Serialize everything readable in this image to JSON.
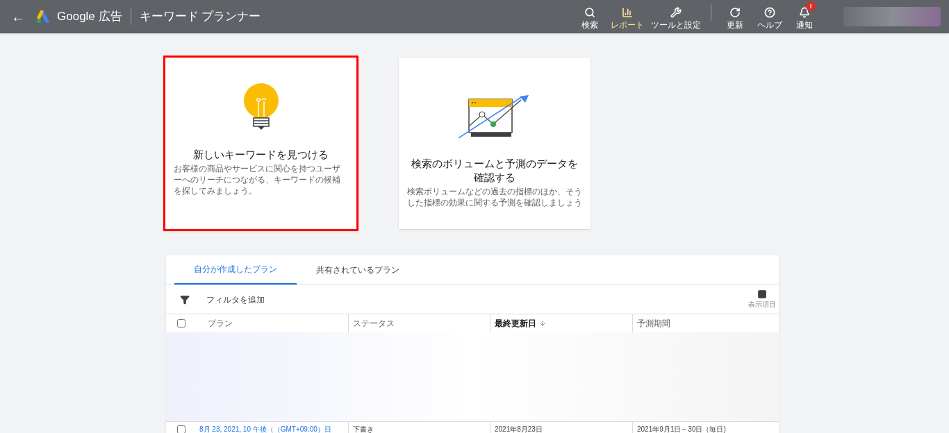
{
  "header": {
    "back": "←",
    "product": "Google 広告",
    "page_title": "キーワード プランナー",
    "actions": [
      {
        "kind": "search",
        "label": "検索",
        "selected": false
      },
      {
        "kind": "report",
        "label": "レポート",
        "selected": true
      },
      {
        "kind": "tools",
        "label": "ツールと設定",
        "selected": false
      },
      {
        "kind": "refresh",
        "label": "更新",
        "selected": false
      },
      {
        "kind": "help",
        "label": "ヘルプ",
        "selected": false
      },
      {
        "kind": "bell",
        "label": "通知",
        "selected": false,
        "badge": "!"
      }
    ]
  },
  "cards": [
    {
      "kind": "bulb",
      "title": "新しいキーワードを見つける",
      "description": "お客様の商品やサービスに関心を持つユーザーへのリーチにつながる、キーワードの候補を探してみましょう。",
      "highlighted": true
    },
    {
      "kind": "chart",
      "title": "検索のボリュームと予測のデータを確認する",
      "description": "検索ボリュームなどの過去の指標のほか、そうした指標の効果に関する予測を確認しましょう",
      "highlighted": false
    }
  ],
  "plans": {
    "tabs": [
      {
        "label": "自分が作成したプラン",
        "selected": true
      },
      {
        "label": "共有されているプラン",
        "selected": false
      }
    ],
    "all_checked": false,
    "filter": "フィルタを追加",
    "columns_button": "表示項目",
    "columns": [
      {
        "label": "プラン",
        "sorted": false
      },
      {
        "label": "ステータス",
        "sorted": false
      },
      {
        "label": "最終更新日",
        "sorted": true
      },
      {
        "label": "予測期間",
        "sorted": false
      }
    ],
    "rows": [
      {
        "checked": false,
        "cells": [
          "8月 23, 2021, 10 午後（（GMT+09:00）日",
          "下書き",
          "2021年8月23日",
          "2021年9月1日～30日（毎日)"
        ]
      }
    ]
  }
}
